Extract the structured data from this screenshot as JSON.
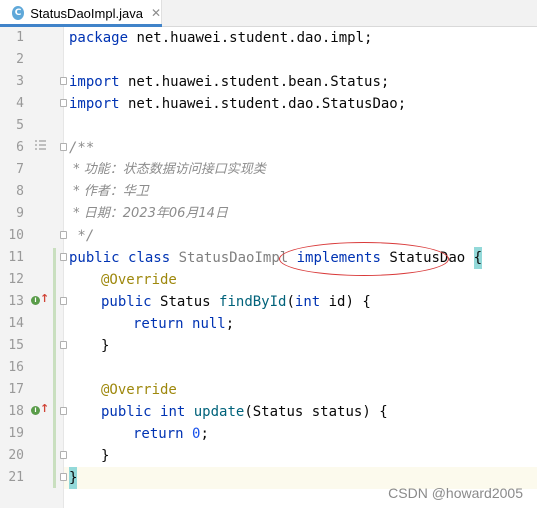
{
  "tab": {
    "title": "StatusDaoImpl.java",
    "icon_letter": "C",
    "close": "✕"
  },
  "line_numbers": [
    "1",
    "2",
    "3",
    "4",
    "5",
    "6",
    "7",
    "8",
    "9",
    "10",
    "11",
    "12",
    "13",
    "14",
    "15",
    "16",
    "17",
    "18",
    "19",
    "20",
    "21"
  ],
  "code": {
    "l1_kw": "package",
    "l1_rest": " net.huawei.student.dao.impl;",
    "l3_kw": "import",
    "l3_rest": " net.huawei.student.bean.Status;",
    "l4_kw": "import",
    "l4_rest": " net.huawei.student.dao.StatusDao;",
    "l6": "/**",
    "l7": " * 功能：状态数据访问接口实现类",
    "l8": " * 作者：华卫",
    "l9": " * 日期：2023年06月14日",
    "l10": " */",
    "l11_kw1": "public",
    "l11_kw2": "class",
    "l11_name": "StatusDaoImpl",
    "l11_kw3": "implements",
    "l11_iface": "StatusDao",
    "l11_brace": "{",
    "l12": "@Override",
    "l13_kw": "public",
    "l13_type": "Status",
    "l13_fn": "findById",
    "l13_open": "(",
    "l13_ptype": "int",
    "l13_rest": " id) {",
    "l14_kw": "return",
    "l14_val": "null",
    "l14_end": ";",
    "l15": "}",
    "l17": "@Override",
    "l18_kw": "public",
    "l18_type": "int",
    "l18_fn": "update",
    "l18_rest": "(Status status) {",
    "l19_kw": "return",
    "l19_val": "0",
    "l19_end": ";",
    "l20": "}",
    "l21": "}"
  },
  "gutter_icons": {
    "implements_marker": "I",
    "arrow": "↑"
  },
  "watermark": "CSDN @howard2005",
  "colors": {
    "keyword": "#0033b3",
    "annotation": "#9e880d",
    "comment": "#8c8c8c",
    "method": "#00627a",
    "number": "#1750eb",
    "circle": "#d93a3a"
  }
}
